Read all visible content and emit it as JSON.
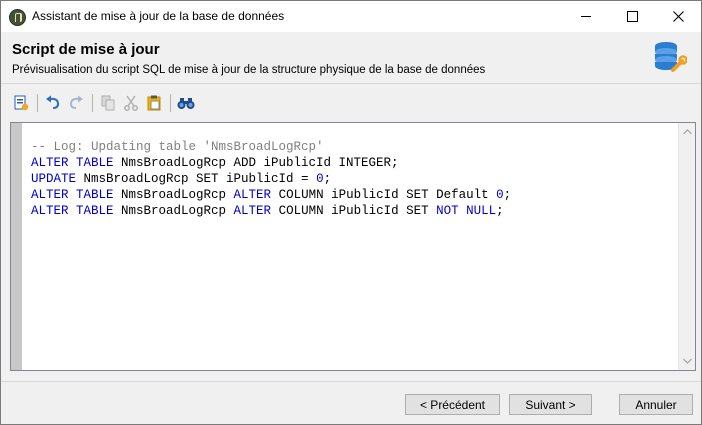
{
  "window": {
    "title": "Assistant de mise à jour de la base de données",
    "controls": {
      "minimize_icon": "minimize-icon",
      "maximize_icon": "maximize-icon",
      "close_icon": "close-icon"
    }
  },
  "header": {
    "title": "Script de mise à jour",
    "subtitle": "Prévisualisation du script SQL de mise à jour de la structure physique de la base de données",
    "icon": "database-wrench-icon"
  },
  "toolbar": {
    "items": [
      {
        "icon": "new-document-icon",
        "enabled": true
      },
      {
        "icon": "undo-icon",
        "enabled": true
      },
      {
        "icon": "redo-icon",
        "enabled": false
      },
      {
        "icon": "copy-icon",
        "enabled": false
      },
      {
        "icon": "cut-icon",
        "enabled": false
      },
      {
        "icon": "paste-icon",
        "enabled": true
      },
      {
        "icon": "find-binoculars-icon",
        "enabled": true
      }
    ]
  },
  "script": {
    "lines": [
      [
        {
          "t": "-- Log: Updating table 'NmsBroadLogRcp'",
          "c": "cm"
        }
      ],
      [
        {
          "t": "ALTER TABLE",
          "c": "kw"
        },
        {
          "t": " NmsBroadLogRcp ADD iPublicId INTEGER;",
          "c": ""
        }
      ],
      [
        {
          "t": "UPDATE",
          "c": "kw"
        },
        {
          "t": " NmsBroadLogRcp SET iPublicId = ",
          "c": ""
        },
        {
          "t": "0",
          "c": "kw"
        },
        {
          "t": ";",
          "c": ""
        }
      ],
      [
        {
          "t": "ALTER TABLE",
          "c": "kw"
        },
        {
          "t": " NmsBroadLogRcp ",
          "c": ""
        },
        {
          "t": "ALTER",
          "c": "kw"
        },
        {
          "t": " COLUMN iPublicId SET Default ",
          "c": ""
        },
        {
          "t": "0",
          "c": "kw"
        },
        {
          "t": ";",
          "c": ""
        }
      ],
      [
        {
          "t": "ALTER TABLE",
          "c": "kw"
        },
        {
          "t": " NmsBroadLogRcp ",
          "c": ""
        },
        {
          "t": "ALTER",
          "c": "kw"
        },
        {
          "t": " COLUMN iPublicId SET ",
          "c": ""
        },
        {
          "t": "NOT NULL",
          "c": "kw"
        },
        {
          "t": ";",
          "c": ""
        }
      ]
    ]
  },
  "buttons": {
    "previous": "< Précédent",
    "next": "Suivant >",
    "cancel": "Annuler"
  },
  "colors": {
    "keyword": "#0000cc",
    "comment": "#808080",
    "gutter": "#c8c8c8"
  }
}
